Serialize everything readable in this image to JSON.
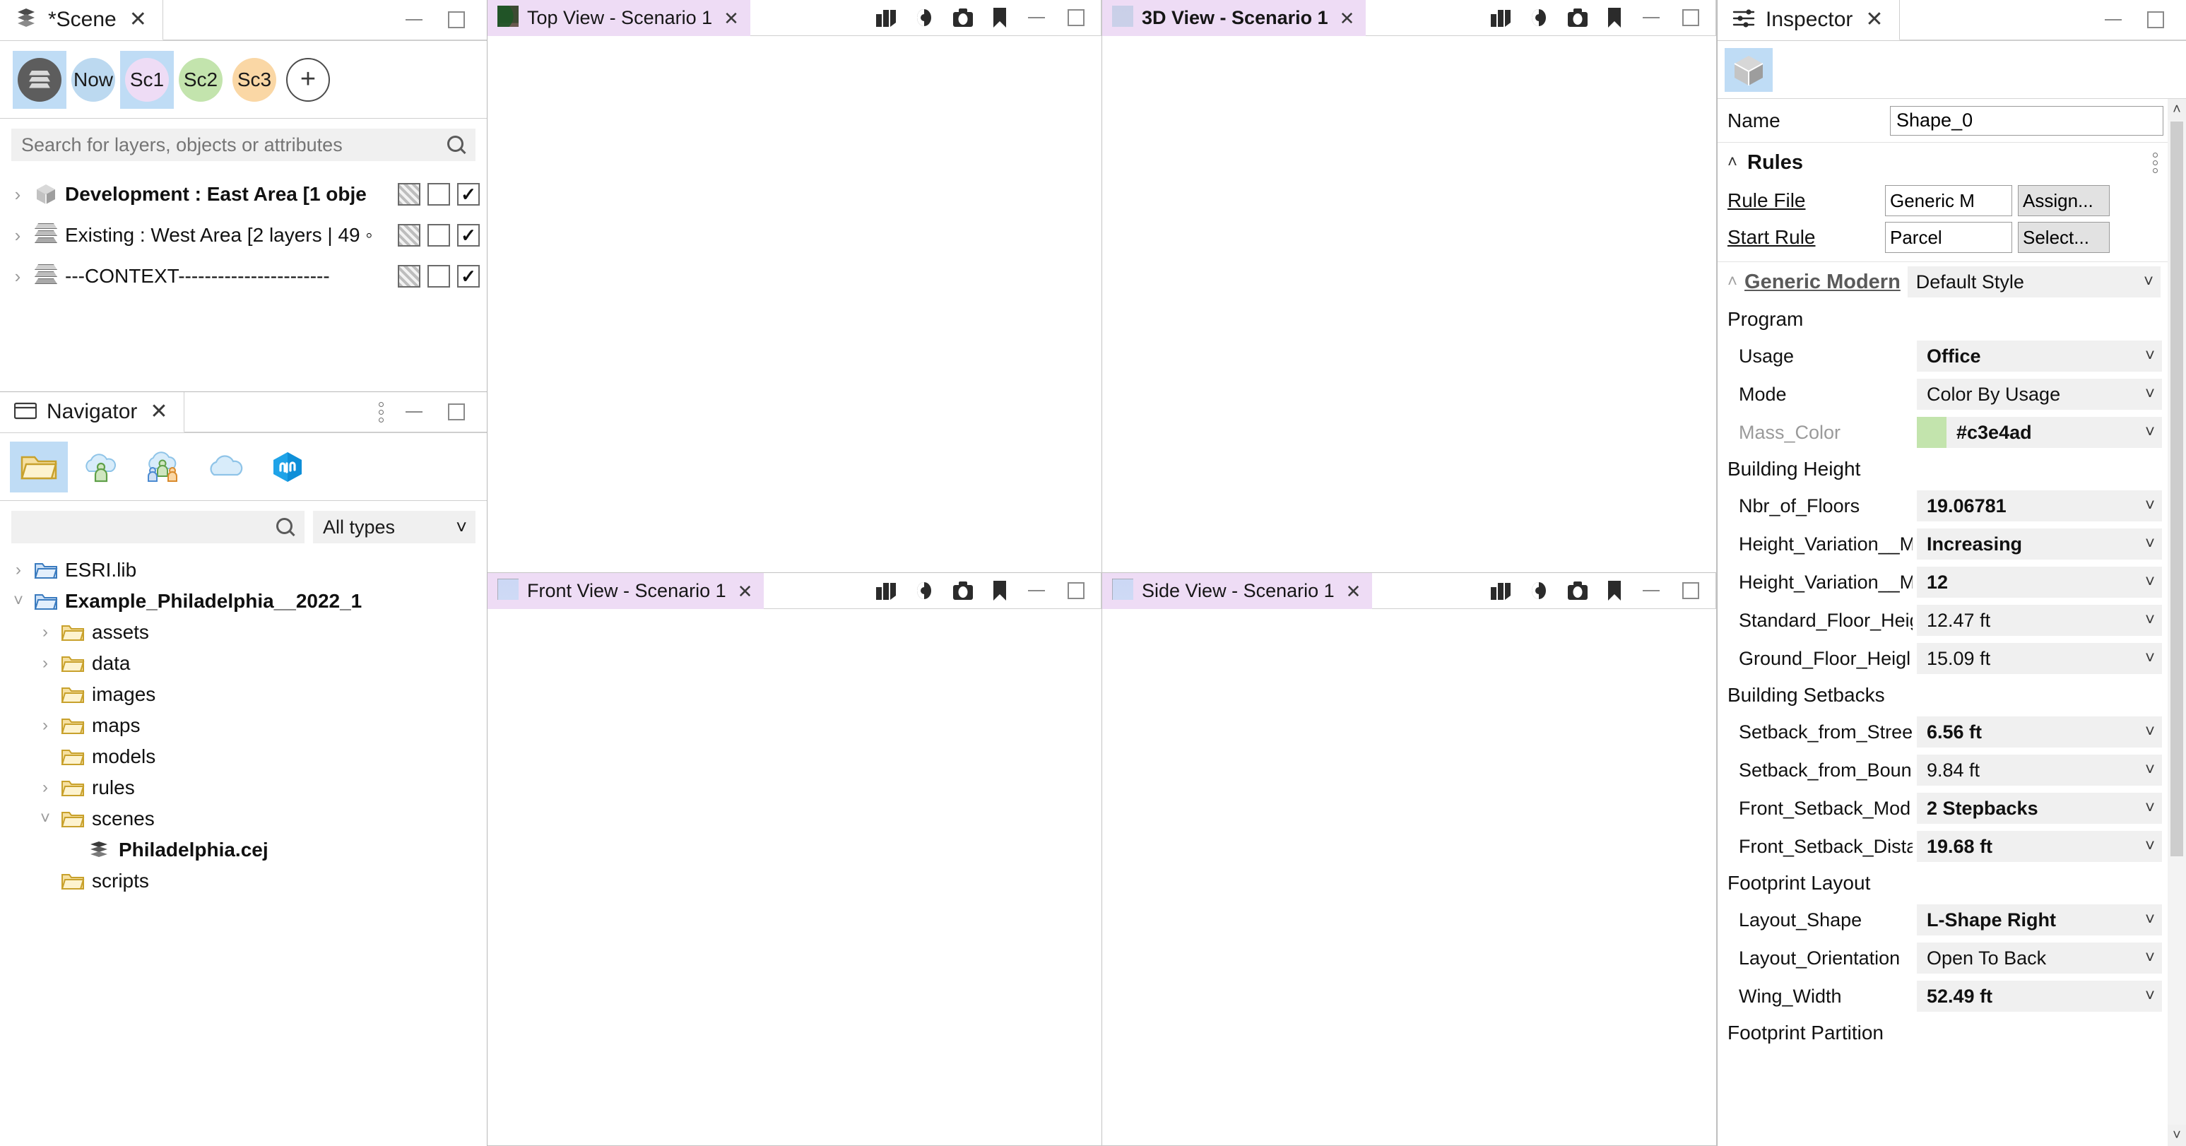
{
  "scene_panel": {
    "tab_title": "*Scene",
    "scenarios": [
      {
        "label": "",
        "icon": "layers-stack-icon",
        "type": "dark",
        "selected": true
      },
      {
        "label": "Now",
        "icon": "",
        "type": "bubble",
        "color": "#bcd9f0",
        "selected": false
      },
      {
        "label": "Sc1",
        "icon": "",
        "type": "bubble",
        "color": "#eedcf5",
        "selected": true
      },
      {
        "label": "Sc2",
        "icon": "",
        "type": "bubble",
        "color": "#c3e4ad",
        "selected": false
      },
      {
        "label": "Sc3",
        "icon": "",
        "type": "bubble",
        "color": "#fad7a5",
        "selected": false
      },
      {
        "label": "+",
        "icon": "add-icon",
        "type": "plus",
        "selected": false
      }
    ],
    "search_placeholder": "Search for layers, objects or attributes",
    "layers": [
      {
        "label": "Development : East Area [1 obje",
        "icon": "cube-icon",
        "bold": true,
        "visible": true
      },
      {
        "label": "Existing : West Area [2 layers | 49 ◦",
        "icon": "layers-icon",
        "bold": false,
        "visible": true
      },
      {
        "label": "---CONTEXT-----------------------",
        "icon": "layers-icon",
        "bold": false,
        "visible": true
      }
    ]
  },
  "navigator_panel": {
    "tab_title": "Navigator",
    "tools": [
      {
        "name": "local-folder-icon",
        "selected": true
      },
      {
        "name": "my-content-cloud-icon",
        "selected": false
      },
      {
        "name": "shared-content-cloud-icon",
        "selected": false
      },
      {
        "name": "public-cloud-icon",
        "selected": false
      },
      {
        "name": "arcgis-online-icon",
        "selected": false
      }
    ],
    "search_value": "",
    "type_filter": "All types",
    "tree": [
      {
        "label": "ESRI.lib",
        "indent": 0,
        "expander": "collapsed",
        "icon": "folder-blue-icon",
        "bold": false
      },
      {
        "label": "Example_Philadelphia__2022_1",
        "indent": 0,
        "expander": "expanded",
        "icon": "folder-blue-icon",
        "bold": true
      },
      {
        "label": "assets",
        "indent": 1,
        "expander": "collapsed",
        "icon": "folder-icon",
        "bold": false
      },
      {
        "label": "data",
        "indent": 1,
        "expander": "collapsed",
        "icon": "folder-icon",
        "bold": false
      },
      {
        "label": "images",
        "indent": 1,
        "expander": "none",
        "icon": "folder-icon",
        "bold": false
      },
      {
        "label": "maps",
        "indent": 1,
        "expander": "collapsed",
        "icon": "folder-icon",
        "bold": false
      },
      {
        "label": "models",
        "indent": 1,
        "expander": "none",
        "icon": "folder-icon",
        "bold": false
      },
      {
        "label": "rules",
        "indent": 1,
        "expander": "collapsed",
        "icon": "folder-icon",
        "bold": false
      },
      {
        "label": "scenes",
        "indent": 1,
        "expander": "expanded",
        "icon": "folder-icon",
        "bold": false
      },
      {
        "label": "Philadelphia.cej",
        "indent": 2,
        "expander": "none",
        "icon": "scene-file-icon",
        "bold": true
      },
      {
        "label": "scripts",
        "indent": 1,
        "expander": "none",
        "icon": "folder-icon",
        "bold": false
      }
    ]
  },
  "viewports": [
    {
      "title": "Top View - Scenario 1",
      "bold": false,
      "kind": "top"
    },
    {
      "title": "3D View - Scenario 1",
      "bold": true,
      "kind": "perspective"
    },
    {
      "title": "Front View - Scenario 1",
      "bold": false,
      "kind": "front"
    },
    {
      "title": "Side View - Scenario 1",
      "bold": false,
      "kind": "side"
    }
  ],
  "viewport_tools": [
    "layers-icon",
    "eye-icon",
    "camera-icon",
    "bookmark-icon"
  ],
  "inspector": {
    "tab_title": "Inspector",
    "tool_icon": "shape-cube-icon",
    "name_label": "Name",
    "name_value": "Shape_0",
    "rules_section": {
      "title": "Rules",
      "rows": [
        {
          "label": "Rule File",
          "value": "Generic M",
          "button": "Assign..."
        },
        {
          "label": "Start Rule",
          "value": "Parcel",
          "button": "Select..."
        }
      ]
    },
    "style_section": {
      "title": "Generic Modern",
      "style": "Default Style"
    },
    "groups": [
      {
        "name": "Program",
        "attributes": [
          {
            "name": "Usage",
            "value": "Office",
            "bold": true,
            "dim": false,
            "swatch": null
          },
          {
            "name": "Mode",
            "value": "Color By Usage",
            "bold": false,
            "dim": false,
            "swatch": null
          },
          {
            "name": "Mass_Color",
            "value": "#c3e4ad",
            "bold": true,
            "dim": true,
            "swatch": "#c3e4ad"
          }
        ]
      },
      {
        "name": "Building Height",
        "attributes": [
          {
            "name": "Nbr_of_Floors",
            "value": "19.06781",
            "bold": true,
            "dim": false,
            "swatch": null
          },
          {
            "name": "Height_Variation__M",
            "value": "Increasing",
            "bold": true,
            "dim": false,
            "swatch": null
          },
          {
            "name": "Height_Variation__M",
            "value": "12",
            "bold": true,
            "dim": false,
            "swatch": null
          },
          {
            "name": "Standard_Floor_Heiɡ",
            "value": "12.47 ft",
            "bold": false,
            "dim": false,
            "swatch": null
          },
          {
            "name": "Ground_Floor_Heigl",
            "value": "15.09 ft",
            "bold": false,
            "dim": false,
            "swatch": null
          }
        ]
      },
      {
        "name": "Building Setbacks",
        "attributes": [
          {
            "name": "Setback_from_Stree",
            "value": "6.56 ft",
            "bold": true,
            "dim": false,
            "swatch": null
          },
          {
            "name": "Setback_from_Boun",
            "value": "9.84 ft",
            "bold": false,
            "dim": false,
            "swatch": null
          },
          {
            "name": "Front_Setback_Mod",
            "value": "2 Stepbacks",
            "bold": true,
            "dim": false,
            "swatch": null
          },
          {
            "name": "Front_Setback_Dista",
            "value": "19.68 ft",
            "bold": true,
            "dim": false,
            "swatch": null
          }
        ]
      },
      {
        "name": "Footprint Layout",
        "attributes": [
          {
            "name": "Layout_Shape",
            "value": "L-Shape Right",
            "bold": true,
            "dim": false,
            "swatch": null
          },
          {
            "name": "Layout_Orientation",
            "value": "Open To Back",
            "bold": false,
            "dim": false,
            "swatch": null
          },
          {
            "name": "Wing_Width",
            "value": "52.49 ft",
            "bold": true,
            "dim": false,
            "swatch": null
          }
        ]
      },
      {
        "name": "Footprint Partition",
        "attributes": []
      }
    ]
  },
  "colors": {
    "selection_blue": "#bfdcf5",
    "tab_lavender": "#eedcf5",
    "mass_cyan": "#6fe0e8",
    "mass_color": "#c3e4ad"
  }
}
